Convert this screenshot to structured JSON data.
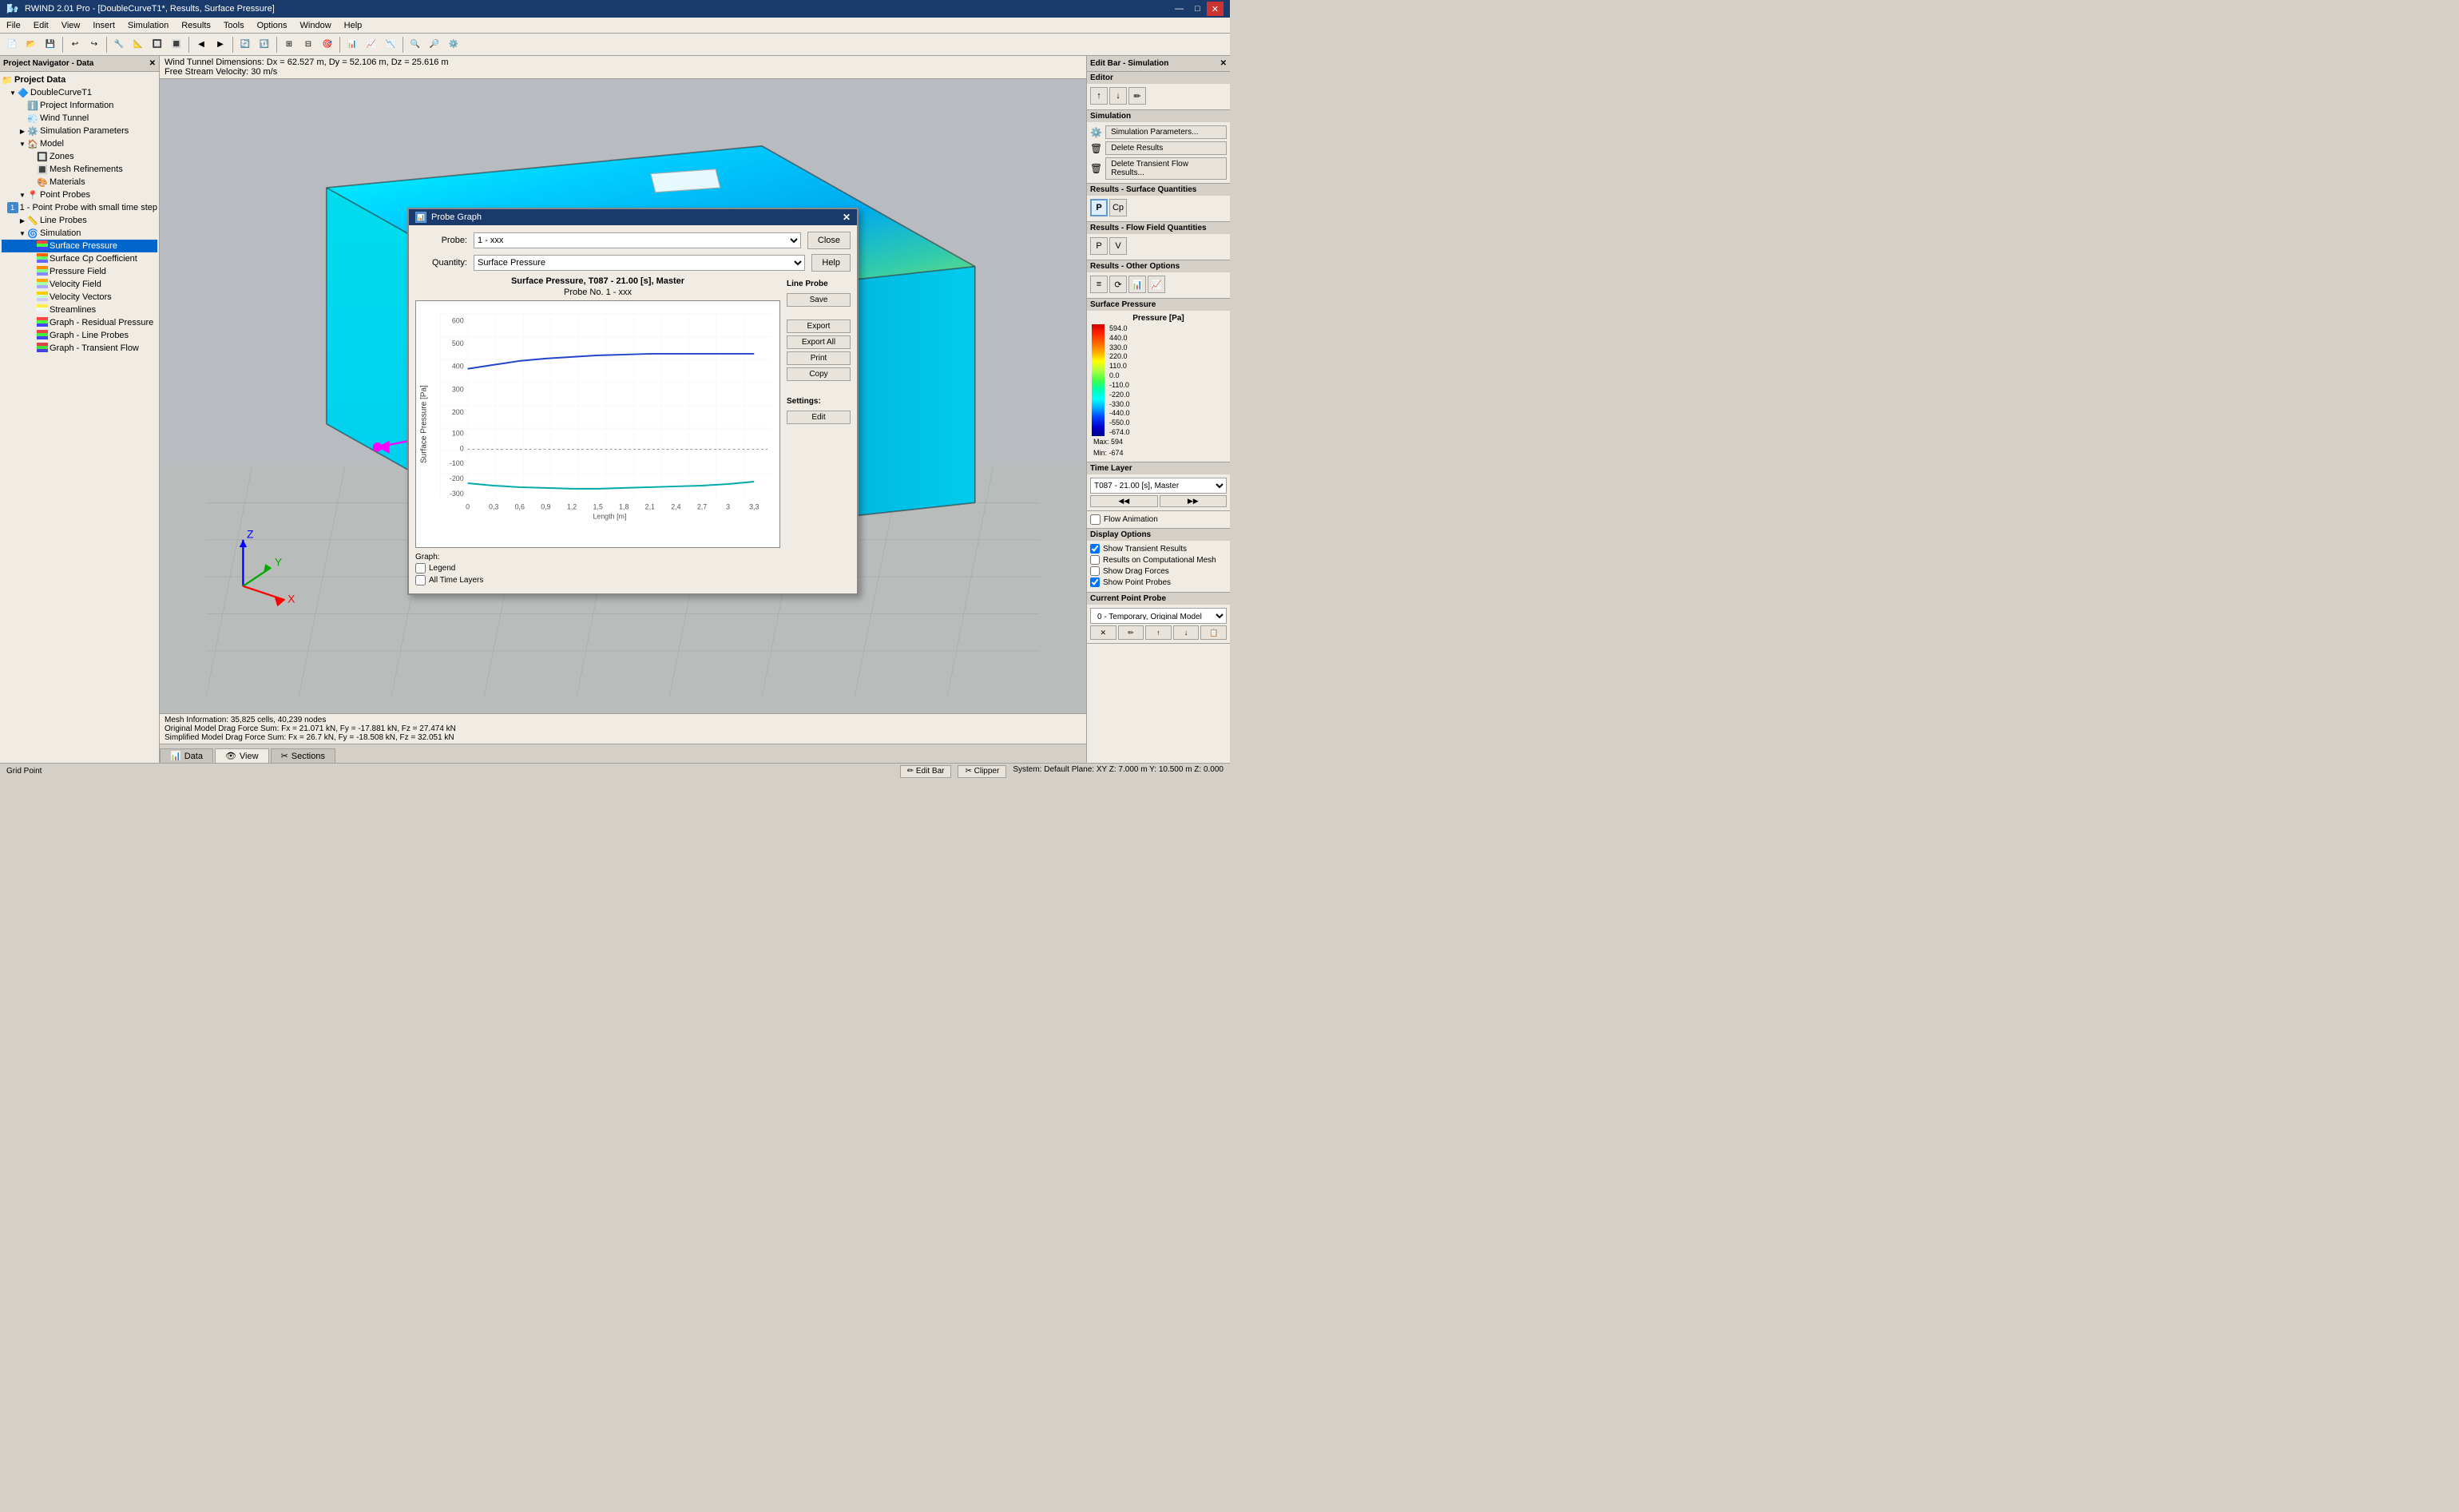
{
  "titleBar": {
    "title": "RWIND 2.01 Pro - [DoubleCurveT1*, Results, Surface Pressure]",
    "minBtn": "—",
    "maxBtn": "□",
    "closeBtn": "✕"
  },
  "menuBar": {
    "items": [
      "File",
      "Edit",
      "View",
      "Insert",
      "Simulation",
      "Results",
      "Tools",
      "Options",
      "Window",
      "Help"
    ]
  },
  "navigator": {
    "title": "Project Navigator - Data",
    "projectData": "Project Data",
    "tree": [
      {
        "label": "DoubleCurveT1",
        "level": 0,
        "expanded": true,
        "type": "project"
      },
      {
        "label": "Project Information",
        "level": 1,
        "type": "info"
      },
      {
        "label": "Wind Tunnel",
        "level": 1,
        "type": "tunnel"
      },
      {
        "label": "Simulation Parameters",
        "level": 1,
        "type": "params",
        "expanded": false
      },
      {
        "label": "Model",
        "level": 1,
        "type": "model",
        "expanded": true
      },
      {
        "label": "Zones",
        "level": 2,
        "type": "zones"
      },
      {
        "label": "Mesh Refinements",
        "level": 2,
        "type": "mesh"
      },
      {
        "label": "Materials",
        "level": 2,
        "type": "materials"
      },
      {
        "label": "Point Probes",
        "level": 1,
        "type": "probes",
        "expanded": true
      },
      {
        "label": "1 - Point Probe with small time step",
        "level": 2,
        "type": "probe-item"
      },
      {
        "label": "Line Probes",
        "level": 1,
        "type": "line-probes",
        "expanded": false
      },
      {
        "label": "Simulation",
        "level": 1,
        "type": "simulation",
        "expanded": true
      },
      {
        "label": "Surface Pressure",
        "level": 2,
        "type": "result-active",
        "selected": true
      },
      {
        "label": "Surface Cp Coefficient",
        "level": 2,
        "type": "result"
      },
      {
        "label": "Pressure Field",
        "level": 2,
        "type": "result"
      },
      {
        "label": "Velocity Field",
        "level": 2,
        "type": "result"
      },
      {
        "label": "Velocity Vectors",
        "level": 2,
        "type": "result"
      },
      {
        "label": "Streamlines",
        "level": 2,
        "type": "result"
      },
      {
        "label": "Graph - Residual Pressure",
        "level": 2,
        "type": "result"
      },
      {
        "label": "Graph - Line Probes",
        "level": 2,
        "type": "result"
      },
      {
        "label": "Graph - Transient Flow",
        "level": 2,
        "type": "result"
      }
    ]
  },
  "viewport": {
    "infoLine1": "Wind Tunnel Dimensions: Dx = 62.527 m, Dy = 52.106 m, Dz = 25.616 m",
    "infoLine2": "Free Stream Velocity: 30 m/s"
  },
  "statusBottomLines": {
    "line1": "Mesh Information: 35,825 cells, 40,239 nodes",
    "line2": "Original Model Drag Force Sum: Fx = 21.071 kN, Fy = -17.881 kN, Fz = 27.474 kN",
    "line3": "Simplified Model Drag Force Sum: Fx = 26.7 kN, Fy = -18.508 kN, Fz = 32.051 kN"
  },
  "editBar": {
    "title": "Edit Bar - Simulation",
    "editorLabel": "Editor",
    "simulationLabel": "Simulation",
    "simParams": "Simulation Parameters...",
    "deleteResults": "Delete Results",
    "deleteTransient": "Delete Transient Flow Results...",
    "surfaceQtyLabel": "Results - Surface Quantities",
    "flowFieldLabel": "Results - Flow Field Quantities",
    "otherOptionsLabel": "Results - Other Options",
    "surfacePressureLabel": "Surface Pressure",
    "pressureUnit": "Pressure [Pa]",
    "legendValues": [
      "594.0",
      "440.0",
      "330.0",
      "220.0",
      "110.0",
      "0.0",
      "-110.0",
      "-220.0",
      "-330.0",
      "-440.0",
      "-550.0",
      "-674.0"
    ],
    "maxLabel": "Max:",
    "maxValue": "594",
    "minLabel": "Min:",
    "minValue": "-674",
    "timeLayerLabel": "Time Layer",
    "timeLayerValue": "T087 - 21.00 [s], Master",
    "flowAnimLabel": "Flow Animation",
    "displayOptionsLabel": "Display Options",
    "showTransient": "Show Transient Results",
    "resultsOnMesh": "Results on Computational Mesh",
    "showDragForces": "Show Drag Forces",
    "showPointProbes": "Show Point Probes",
    "currentProbeLabel": "Current Point Probe",
    "currentProbeValue": "0 - Temporary, Original Model"
  },
  "probeGraph": {
    "title": "Probe Graph",
    "probeLabel": "Probe:",
    "probeValue": "1 - xxx",
    "quantityLabel": "Quantity:",
    "quantityValue": "Surface Pressure",
    "closeBtn": "Close",
    "helpBtn": "Help",
    "chartTitle": "Surface Pressure, T087 - 21.00 [s], Master",
    "chartSubtitle": "Probe No. 1 - xxx",
    "yAxisLabel": "Surface Pressure [Pa]",
    "xAxisLabel": "Length [m]",
    "yAxisValues": [
      "600",
      "500",
      "400",
      "300",
      "200",
      "100",
      "0",
      "-100",
      "-200",
      "-300"
    ],
    "xAxisValues": [
      "0",
      "0,3",
      "0,6",
      "0,9",
      "1,2",
      "1,5",
      "1,8",
      "2,1",
      "2,4",
      "2,7",
      "3",
      "3,3"
    ],
    "lineProbeSectionLabel": "Line Probe",
    "saveBtn": "Save",
    "graphLabel": "Graph:",
    "legendCheck": "Legend",
    "allTimeLayersCheck": "All Time Layers",
    "exportBtn": "Export",
    "exportAllBtn": "Export All",
    "printBtn": "Print",
    "copyBtn": "Copy",
    "settingsLabel": "Settings:",
    "editBtn": "Edit"
  },
  "bottomTabs": [
    {
      "label": "Data",
      "icon": "📊",
      "active": false
    },
    {
      "label": "View",
      "icon": "👁",
      "active": false
    },
    {
      "label": "Sections",
      "icon": "✂",
      "active": false
    }
  ],
  "statusBar": {
    "left": "Grid Point",
    "editBarBtn": "Edit Bar",
    "clipperBtn": "Clipper",
    "systemDefault": "System: Default  Plane: XY  Z: 7.000 m  Y: 10.500 m  Z: 0.000"
  }
}
